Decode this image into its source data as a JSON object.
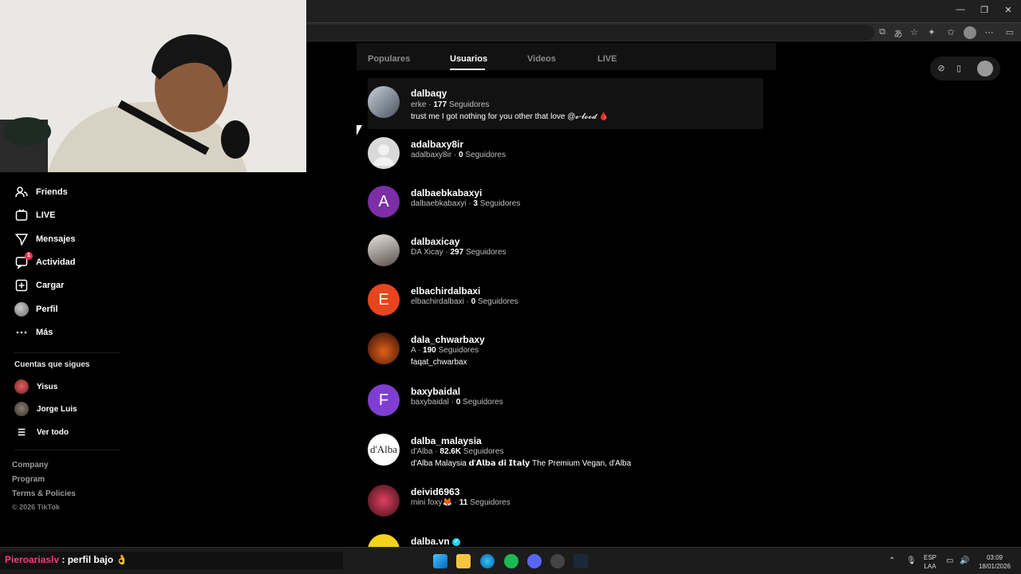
{
  "window": {
    "minimize_glyph": "—",
    "restore_glyph": "❐",
    "close_glyph": "✕"
  },
  "sidebar": {
    "items": [
      {
        "label": "Friends",
        "icon": "friends-icon"
      },
      {
        "label": "LIVE",
        "icon": "live-icon"
      },
      {
        "label": "Mensajes",
        "icon": "messages-icon"
      },
      {
        "label": "Actividad",
        "icon": "activity-icon",
        "badge": "1"
      },
      {
        "label": "Cargar",
        "icon": "upload-icon"
      },
      {
        "label": "Perfil",
        "icon": "profile-avatar"
      },
      {
        "label": "Más",
        "icon": "more-icon"
      }
    ],
    "following_title": "Cuentas que sigues",
    "following": [
      {
        "label": "Yisus"
      },
      {
        "label": "Jorge Luis"
      }
    ],
    "see_all": "Ver todo",
    "footer": [
      "Company",
      "Program",
      "Terms & Policies"
    ],
    "copyright": "© 2026 TikTok"
  },
  "tabs": [
    "Populares",
    "Usuarios",
    "Videos",
    "LIVE"
  ],
  "active_tab": "Usuarios",
  "results": [
    {
      "username": "dalbaqy",
      "nickname": "erke",
      "followers": "177",
      "followers_label": "Seguidores",
      "bio": "trust me I got nothing for you other that love @𝓮-𝓵𝓸𝓸𝓭 🩸",
      "avatar": "photo",
      "avatar_color": "#7a8794"
    },
    {
      "username": "adalbaxy8ir",
      "nickname": "adalbaxy8ir",
      "followers": "0",
      "followers_label": "Seguidores",
      "bio": "",
      "avatar": "default",
      "avatar_color": "#d9d9d9"
    },
    {
      "username": "dalbaebkabaxyi",
      "nickname": "dalbaebkabaxyi",
      "followers": "3",
      "followers_label": "Seguidores",
      "bio": "",
      "avatar": "A",
      "avatar_color": "#7b2ea6"
    },
    {
      "username": "dalbaxicay",
      "nickname": "DA Xicay",
      "followers": "297",
      "followers_label": "Seguidores",
      "bio": "",
      "avatar": "photo",
      "avatar_color": "#9a8f8a"
    },
    {
      "username": "elbachirdalbaxi",
      "nickname": "elbachirdalbaxi",
      "followers": "0",
      "followers_label": "Seguidores",
      "bio": "",
      "avatar": "E",
      "avatar_color": "#e8451e"
    },
    {
      "username": "dala_chwarbaxy",
      "nickname": "A",
      "followers": "190",
      "followers_label": "Seguidores",
      "bio": "faqat_chwarbax",
      "avatar": "photo",
      "avatar_color": "#8a3a12"
    },
    {
      "username": "baxybaidal",
      "nickname": "baxybaidal",
      "followers": "0",
      "followers_label": "Seguidores",
      "bio": "",
      "avatar": "F",
      "avatar_color": "#7e3fd0"
    },
    {
      "username": "dalba_malaysia",
      "nickname": "d'Alba",
      "followers": "82.6K",
      "followers_label": "Seguidores",
      "bio": "d'Alba Malaysia 𝗱'𝗔𝗹𝗯𝗮 𝗱𝗶 𝗜𝘁𝗮𝗹𝘆 The Premium Vegan, d'Alba",
      "avatar": "d'Alba",
      "avatar_color": "#ffffff"
    },
    {
      "username": "deivid6963",
      "nickname": "mini foxy🦊",
      "followers": "11",
      "followers_label": "Seguidores",
      "bio": "",
      "avatar": "photo",
      "avatar_color": "#b0304a"
    },
    {
      "username": "dalba.vn",
      "nickname": "",
      "followers": "",
      "followers_label": "",
      "bio": "",
      "avatar": "photo",
      "avatar_color": "#f2d21b",
      "verified": true
    }
  ],
  "chat": {
    "user": "Pieroariaslv",
    "message": " : perfil bajo 👌"
  },
  "tray": {
    "lang1": "ESP",
    "lang2": "LAA",
    "time": "03:09",
    "date": "18/01/2026"
  },
  "colors": {
    "accent": "#fe2c55",
    "background": "#000000"
  }
}
